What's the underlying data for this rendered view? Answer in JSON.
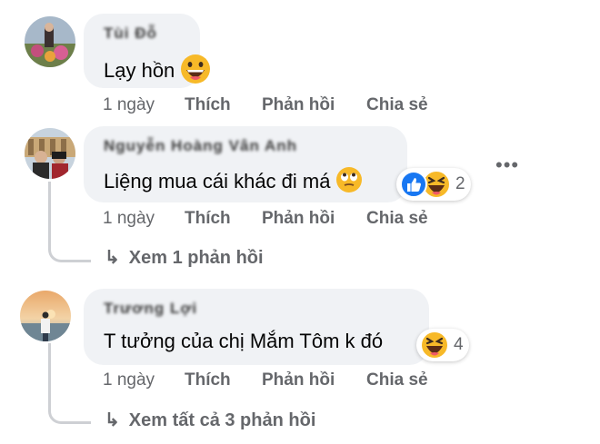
{
  "comments": [
    {
      "author": "Tùi Đỗ",
      "text": "Lạy hồn",
      "time": "1 ngày",
      "like_label": "Thích",
      "reply_label": "Phản hồi",
      "share_label": "Chia sẻ",
      "emoji_icon": "grinning-face-emoji"
    },
    {
      "author": "Nguyễn Hoàng Vân Anh",
      "text": "Liệng mua cái khác đi má",
      "time": "1 ngày",
      "like_label": "Thích",
      "reply_label": "Phản hồi",
      "share_label": "Chia sẻ",
      "emoji_icon": "rolling-eyes-emoji",
      "reaction_count": "2",
      "reaction_icons": [
        "like-icon",
        "haha-icon"
      ],
      "view_replies": "Xem 1 phản hồi"
    },
    {
      "author": "Trương Lợi",
      "text": "T tưởng của chị Mắm Tôm k đó",
      "time": "1 ngày",
      "like_label": "Thích",
      "reply_label": "Phản hồi",
      "share_label": "Chia sẻ",
      "reaction_count": "4",
      "reaction_icons": [
        "haha-icon"
      ],
      "view_replies": "Xem tất cả 3 phản hồi"
    }
  ],
  "more_options": "•••",
  "colors": {
    "bubble": "#f0f2f5",
    "secondary_text": "#65676b",
    "like_blue": "#1877f2",
    "haha_yellow": "#f7b928"
  }
}
